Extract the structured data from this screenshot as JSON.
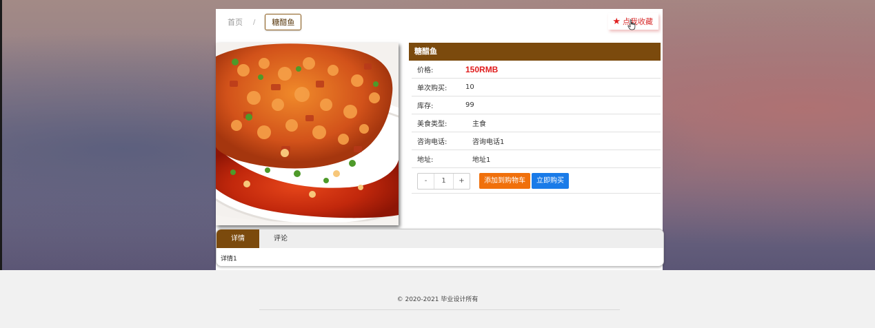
{
  "breadcrumb": {
    "home": "首页",
    "separator": "/",
    "current": "糖醋鱼"
  },
  "favorite": {
    "label": "点我收藏",
    "icon": "star-icon"
  },
  "product": {
    "title": "糖醋鱼",
    "image_alt": "sweet-and-sour fish dish",
    "rows": [
      {
        "label": "价格:",
        "value": "150RMB"
      },
      {
        "label": "单次购买:",
        "value": "10"
      },
      {
        "label": "库存:",
        "value": "99"
      },
      {
        "label": "美食类型:",
        "value": "主食"
      },
      {
        "label": "咨询电话:",
        "value": "咨询电话1"
      },
      {
        "label": "地址:",
        "value": "地址1"
      }
    ]
  },
  "quantity": {
    "minus": "-",
    "value": "1",
    "plus": "+"
  },
  "actions": {
    "add_to_cart": "添加到购物车",
    "buy_now": "立即购买"
  },
  "tabs": [
    {
      "label": "详情",
      "active": true
    },
    {
      "label": "评论",
      "active": false
    }
  ],
  "detail_text": "详情1",
  "footer": {
    "copyright": "© 2020-2021 毕业设计所有"
  },
  "colors": {
    "brand_brown": "#7b4a0d",
    "price_red": "#e01b1b",
    "cart_orange": "#f0700b",
    "buy_blue": "#1a7be8"
  }
}
